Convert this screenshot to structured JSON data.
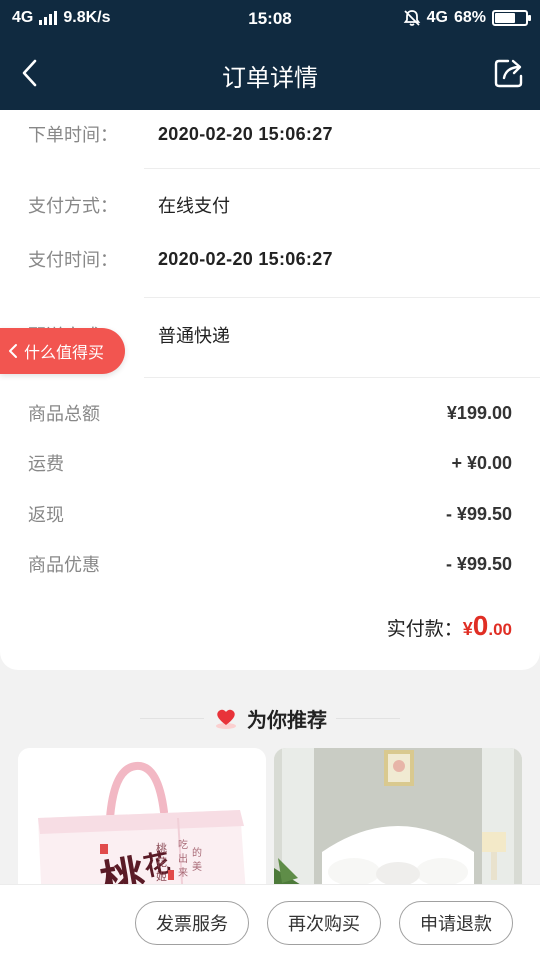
{
  "status_bar": {
    "network_left": "4G",
    "speed": "9.8K/s",
    "time": "15:08",
    "network_right": "4G",
    "battery": "68%",
    "battery_level": 0.68
  },
  "nav": {
    "title": "订单详情"
  },
  "order_info": {
    "order_time_label": "下单时间：",
    "order_time": "2020-02-20 15:06:27",
    "pay_method_label": "支付方式：",
    "pay_method": "在线支付",
    "pay_time_label": "支付时间：",
    "pay_time": "2020-02-20 15:06:27",
    "delivery_label": "配送方式：",
    "delivery": "普通快递"
  },
  "amounts": {
    "goods_total_label": "商品总额",
    "goods_total": "¥199.00",
    "shipping_label": "运费",
    "shipping": "+ ¥0.00",
    "cashback_label": "返现",
    "cashback": "- ¥99.50",
    "discount_label": "商品优惠",
    "discount": "- ¥99.50",
    "paid_label": "实付款：",
    "paid_currency": "¥",
    "paid_int": "0",
    "paid_dec": ".00"
  },
  "floating_tag": {
    "label": "什么值得买"
  },
  "recommend": {
    "title": "为你推荐"
  },
  "actions": {
    "invoice": "发票服务",
    "rebuy": "再次购买",
    "refund": "申请退款"
  },
  "colors": {
    "header_bg": "#102a40",
    "price_red": "#e02e24",
    "tag_red": "#f25550"
  }
}
